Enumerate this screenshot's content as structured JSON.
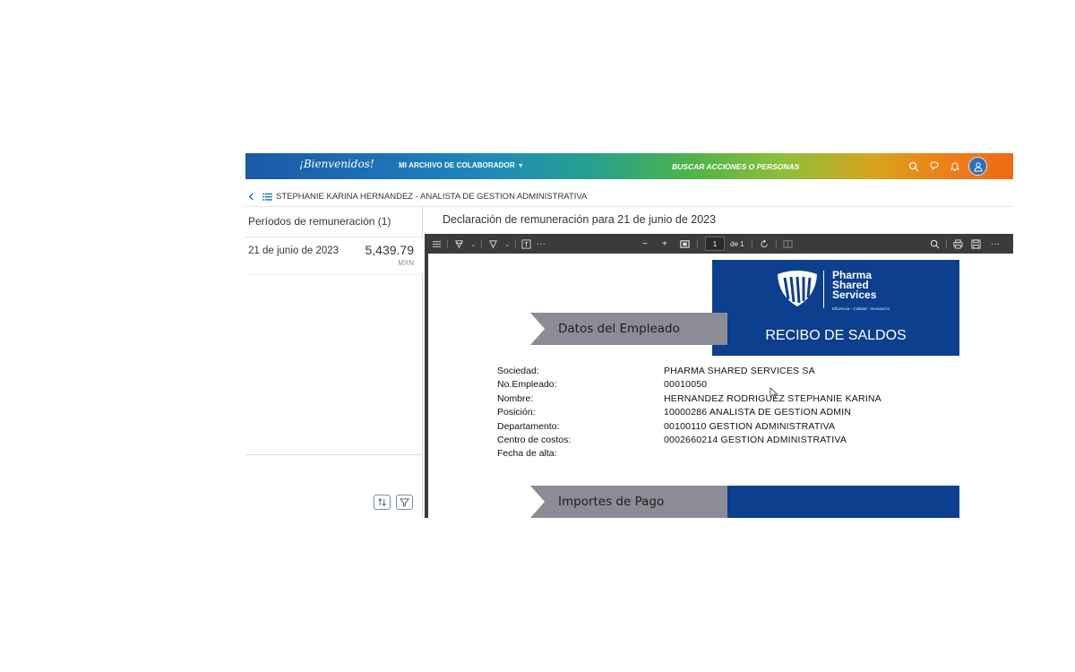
{
  "shell": {
    "brand": "¡Bienvenidos!",
    "menu_label": "MI ARCHIVO DE COLABORADOR",
    "search_placeholder": "BUSCAR ACCIONES O PERSONAS",
    "icons": [
      "search-icon",
      "help-icon",
      "bell-icon",
      "user-icon"
    ]
  },
  "header": {
    "title": "STEPHANIE KARINA HERNANDEZ - ANALISTA DE GESTION ADMINISTRATIVA"
  },
  "left_panel": {
    "title": "Períodos de remuneración (1)",
    "periods": [
      {
        "date": "21 de junio de 2023",
        "amount": "5,439.79",
        "currency": "MXN"
      }
    ]
  },
  "right_panel": {
    "title": "Declaración de remuneración para 21 de junio de 2023",
    "pdf_toolbar": {
      "page": "1",
      "page_of": "de 1"
    }
  },
  "document": {
    "logo_lines": [
      "Pharma",
      "Shared",
      "Services"
    ],
    "logo_tagline": "Eficiencia - Calidad - Innovación",
    "banner_title": "RECIBO DE SALDOS",
    "section1": "Datos del Empleado",
    "section2": "Importes de Pago",
    "fields": [
      {
        "label": "Sociedad:",
        "value": "PHARMA SHARED SERVICES SA"
      },
      {
        "label": "No.Empleado:",
        "value": "00010050"
      },
      {
        "label": "Nombre:",
        "value": "HERNANDEZ RODRIGUEZ STEPHANIE KARINA"
      },
      {
        "label": "Posición:",
        "value": "10000286 ANALISTA DE GESTION ADMIN"
      },
      {
        "label": "Departamento:",
        "value": "00100110 GESTION ADMINISTRATIVA"
      },
      {
        "label": "Centro de costos:",
        "value": "0002660214 GESTION ADMINISTRATIVA"
      },
      {
        "label": "Fecha de alta:",
        "value": ""
      }
    ]
  },
  "colors": {
    "doc_blue": "#0c3f8e",
    "section_gray": "#8b8c95",
    "pdf_toolbar": "#3b3b3b"
  }
}
